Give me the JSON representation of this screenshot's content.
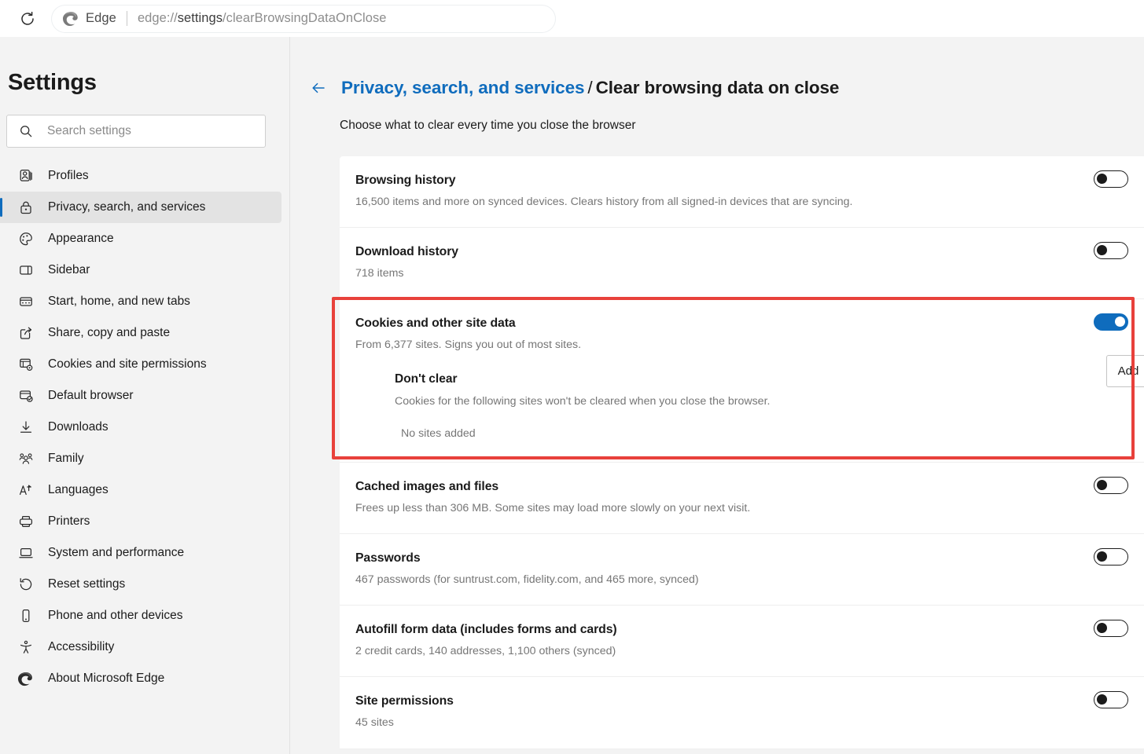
{
  "topbar": {
    "reload_icon": "reload-icon",
    "app_name": "Edge",
    "url_scheme": "edge://",
    "url_bold": "settings",
    "url_rest": "/clearBrowsingDataOnClose",
    "url_full": "edge://settings/clearBrowsingDataOnClose"
  },
  "sidebar": {
    "title": "Settings",
    "search": {
      "placeholder": "Search settings",
      "value": "",
      "icon": "search-icon"
    },
    "items": [
      {
        "label": "Profiles",
        "icon": "profile-icon",
        "selected": false
      },
      {
        "label": "Privacy, search, and services",
        "icon": "lock-icon",
        "selected": true
      },
      {
        "label": "Appearance",
        "icon": "palette-icon",
        "selected": false
      },
      {
        "label": "Sidebar",
        "icon": "sidebar-icon",
        "selected": false
      },
      {
        "label": "Start, home, and new tabs",
        "icon": "window-icon",
        "selected": false
      },
      {
        "label": "Share, copy and paste",
        "icon": "share-icon",
        "selected": false
      },
      {
        "label": "Cookies and site permissions",
        "icon": "cookie-permissions-icon",
        "selected": false
      },
      {
        "label": "Default browser",
        "icon": "default-browser-icon",
        "selected": false
      },
      {
        "label": "Downloads",
        "icon": "download-icon",
        "selected": false
      },
      {
        "label": "Family",
        "icon": "family-icon",
        "selected": false
      },
      {
        "label": "Languages",
        "icon": "languages-icon",
        "selected": false
      },
      {
        "label": "Printers",
        "icon": "printer-icon",
        "selected": false
      },
      {
        "label": "System and performance",
        "icon": "laptop-icon",
        "selected": false
      },
      {
        "label": "Reset settings",
        "icon": "reset-icon",
        "selected": false
      },
      {
        "label": "Phone and other devices",
        "icon": "phone-icon",
        "selected": false
      },
      {
        "label": "Accessibility",
        "icon": "accessibility-icon",
        "selected": false
      },
      {
        "label": "About Microsoft Edge",
        "icon": "edge-logo-icon",
        "selected": false
      }
    ]
  },
  "main": {
    "back_icon": "back-arrow-icon",
    "breadcrumb_parent": "Privacy, search, and services",
    "breadcrumb_separator": "/",
    "breadcrumb_current": "Clear browsing data on close",
    "subtitle": "Choose what to clear every time you close the browser",
    "rows": [
      {
        "title": "Browsing history",
        "desc": "16,500 items and more on synced devices. Clears history from all signed-in devices that are syncing.",
        "toggle": "off"
      },
      {
        "title": "Download history",
        "desc": "718 items",
        "toggle": "off"
      },
      {
        "title": "Cookies and other site data",
        "desc": "From 6,377 sites. Signs you out of most sites.",
        "toggle": "on",
        "subsection": {
          "title": "Don't clear",
          "desc": "Cookies for the following sites won't be cleared when you close the browser.",
          "empty_note": "No sites added",
          "add_label": "Add"
        }
      },
      {
        "title": "Cached images and files",
        "desc": "Frees up less than 306 MB. Some sites may load more slowly on your next visit.",
        "toggle": "off"
      },
      {
        "title": "Passwords",
        "desc": "467 passwords (for suntrust.com, fidelity.com, and 465 more, synced)",
        "toggle": "off"
      },
      {
        "title": "Autofill form data (includes forms and cards)",
        "desc": "2 credit cards, 140 addresses, 1,100 others (synced)",
        "toggle": "off"
      },
      {
        "title": "Site permissions",
        "desc": "45 sites",
        "toggle": "off"
      }
    ]
  },
  "annotation": {
    "highlight_color": "#e8413b",
    "target": "Cookies and other site data"
  },
  "colors": {
    "accent": "#0f6cbd",
    "page_background": "#f3f3f3",
    "card_background": "#ffffff",
    "text_primary": "#1b1b1b",
    "text_secondary": "#767676"
  }
}
